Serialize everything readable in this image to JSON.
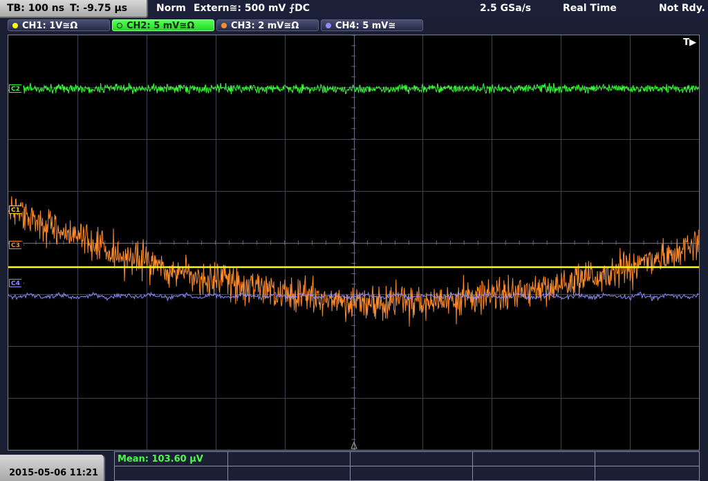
{
  "header": {
    "timebase": "TB: 100 ns",
    "trigger_pos": "T: -9.75 µs",
    "mode": "Norm",
    "trigger_source": "Extern≅: 500 mV ⨍DC",
    "sample_rate": "2.5 GSa/s",
    "acq_mode": "Real Time",
    "status": "Not Rdy."
  },
  "channels": [
    {
      "label": "CH1: 1V≅Ω",
      "color": "#ffff00",
      "active": false
    },
    {
      "label": "CH2: 5 mV≅Ω",
      "color": "#33ff33",
      "active": true
    },
    {
      "label": "CH3: 2 mV≅Ω",
      "color": "#ff8c2a",
      "active": false
    },
    {
      "label": "CH4: 5 mV≅",
      "color": "#8c8cff",
      "active": false
    }
  ],
  "markers": [
    {
      "label": "C1",
      "color": "#ffd000"
    },
    {
      "label": "C2",
      "color": "#33ff33"
    },
    {
      "label": "C3",
      "color": "#ff8c2a"
    },
    {
      "label": "C4",
      "color": "#8c8cff"
    }
  ],
  "trigger_indicator": "T▶",
  "footer": {
    "datetime": "2015-05-06 11:21",
    "measurement": "Mean: 103.60 µV"
  },
  "icons": {
    "trigger_arrow": "triangle-icon",
    "channel_dot": "dot-icon"
  }
}
